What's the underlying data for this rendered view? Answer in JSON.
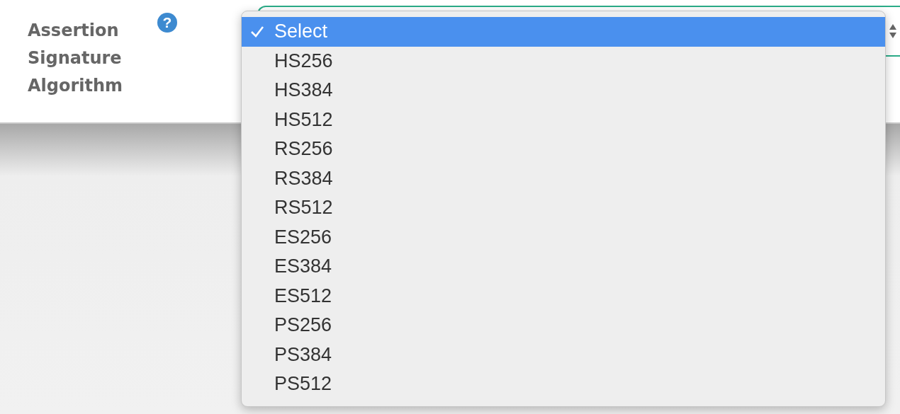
{
  "field": {
    "label": "Assertion Signature Algorithm",
    "help": "?"
  },
  "dropdown": {
    "options": [
      {
        "label": "Select",
        "selected": true
      },
      {
        "label": "HS256",
        "selected": false
      },
      {
        "label": "HS384",
        "selected": false
      },
      {
        "label": "HS512",
        "selected": false
      },
      {
        "label": "RS256",
        "selected": false
      },
      {
        "label": "RS384",
        "selected": false
      },
      {
        "label": "RS512",
        "selected": false
      },
      {
        "label": "ES256",
        "selected": false
      },
      {
        "label": "ES384",
        "selected": false
      },
      {
        "label": "ES512",
        "selected": false
      },
      {
        "label": "PS256",
        "selected": false
      },
      {
        "label": "PS384",
        "selected": false
      },
      {
        "label": "PS512",
        "selected": false
      }
    ]
  }
}
